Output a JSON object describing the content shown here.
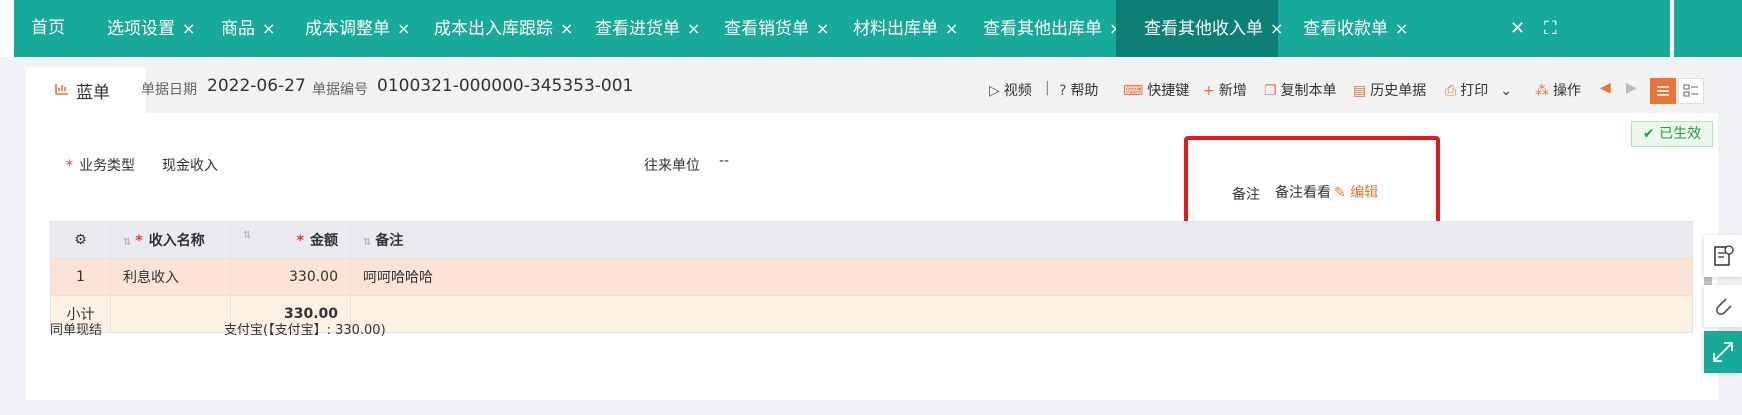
{
  "tabs": [
    {
      "label": "首页",
      "closable": false
    },
    {
      "label": "选项设置",
      "closable": true
    },
    {
      "label": "商品",
      "closable": true
    },
    {
      "label": "成本调整单",
      "closable": true
    },
    {
      "label": "成本出入库跟踪",
      "closable": true
    },
    {
      "label": "查看进货单",
      "closable": true
    },
    {
      "label": "查看销货单",
      "closable": true
    },
    {
      "label": "材料出库单",
      "closable": true
    },
    {
      "label": "查看其他出库单",
      "closable": true
    },
    {
      "label": "查看其他收入单",
      "closable": true,
      "active": true
    },
    {
      "label": "查看收款单",
      "closable": true
    }
  ],
  "close_glyph": "×",
  "window_controls": {
    "close": "✕",
    "fullscreen": "⛶"
  },
  "doc": {
    "type_tab": "蓝单",
    "date_label": "单据日期",
    "date_value": "2022-06-27",
    "number_label": "单据编号",
    "number_value": "0100321-000000-345353-001"
  },
  "toolbar": {
    "video": "视频",
    "sep": "|",
    "help": "帮助",
    "shortcuts": "快捷键",
    "new": "新增",
    "copy": "复制本单",
    "history": "历史单据",
    "print": "打印",
    "operate": "操作"
  },
  "status_badge": "已生效",
  "form": {
    "biz_type_label": "业务类型",
    "biz_type_value": "现金收入",
    "partner_label": "往来单位",
    "partner_value": "--",
    "remark_label": "备注",
    "remark_value": "备注看看",
    "edit_label": "编辑"
  },
  "table": {
    "headers": {
      "name": "收入名称",
      "amount": "金额",
      "remark": "备注"
    },
    "rows": [
      {
        "index": "1",
        "name": "利息收入",
        "amount": "330.00",
        "remark": "呵呵哈哈哈"
      }
    ],
    "subtotal": {
      "label": "小计",
      "amount": "330.00"
    }
  },
  "footer": {
    "cash_label": "同单现结",
    "cash_value": "支付宝(【支付宝】: 330.00)"
  },
  "colors": {
    "accent": "#17a99a",
    "accent_dark": "#0e7f74",
    "orange": "#e8763a",
    "highlight_box": "#e21c1c"
  }
}
